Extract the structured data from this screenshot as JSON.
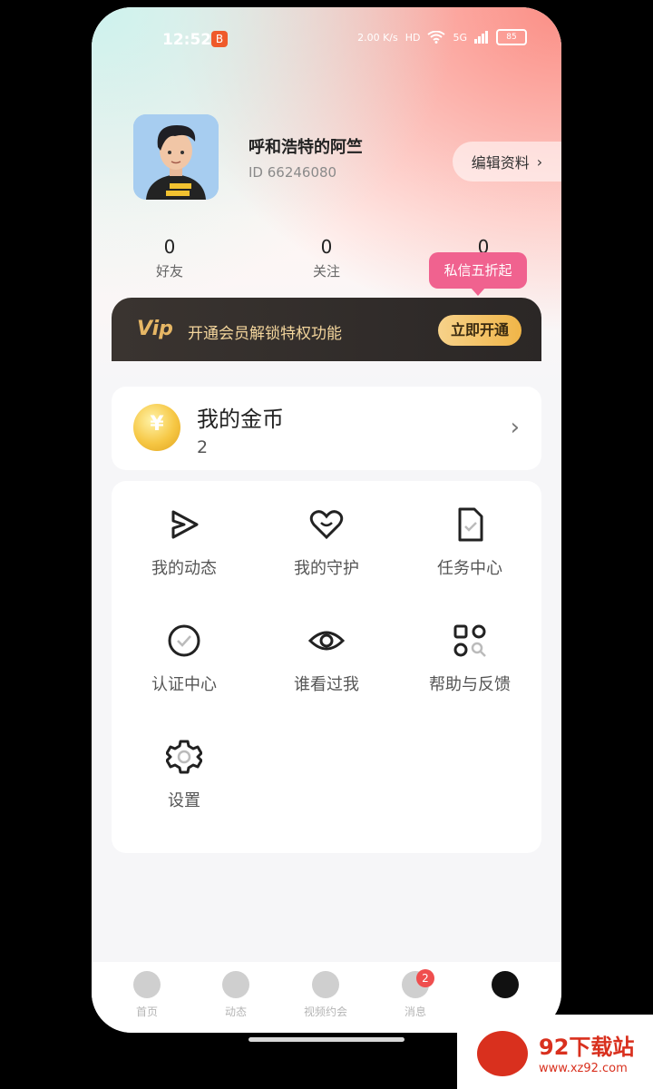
{
  "status_bar": {
    "time": "12:52",
    "app_badge": "B",
    "net_speed": "2.00 K/s",
    "hd": "HD",
    "signal": "5G",
    "battery": "85"
  },
  "profile": {
    "name": "呼和浩特的阿竺",
    "id": "ID 66246080",
    "edit_label": "编辑资料",
    "edit_chevron": "›"
  },
  "stats": [
    {
      "value": "0",
      "label": "好友"
    },
    {
      "value": "0",
      "label": "关注"
    },
    {
      "value": "0",
      "label": "私信五折起"
    }
  ],
  "vip": {
    "logo": "Vip",
    "text": "开通会员解锁特权功能",
    "button": "立即开通"
  },
  "coins": {
    "title": "我的金币",
    "value": "2",
    "symbol": "¥",
    "chevron": "›"
  },
  "menu": [
    {
      "label": "我的动态",
      "icon": "send-icon"
    },
    {
      "label": "我的守护",
      "icon": "heart-icon"
    },
    {
      "label": "任务中心",
      "icon": "document-icon"
    },
    {
      "label": "认证中心",
      "icon": "check-circle-icon"
    },
    {
      "label": "谁看过我",
      "icon": "eye-icon"
    },
    {
      "label": "帮助与反馈",
      "icon": "help-grid-icon"
    },
    {
      "label": "设置",
      "icon": "gear-icon"
    }
  ],
  "tabbar": [
    {
      "label": "首页",
      "icon": "home-icon"
    },
    {
      "label": "动态",
      "icon": "compass-icon"
    },
    {
      "label": "视频约会",
      "icon": "video-icon"
    },
    {
      "label": "消息",
      "icon": "message-icon"
    },
    {
      "label": "",
      "icon": "profile-icon"
    }
  ],
  "tab_badge": "2",
  "watermark": {
    "title": "92下载站",
    "url": "www.xz92.com"
  },
  "colors": {
    "accent_pink": "#f0628f",
    "vip_gold": "#f0b548",
    "vip_dark": "#2b2726",
    "coin_gold": "#f6c744"
  }
}
